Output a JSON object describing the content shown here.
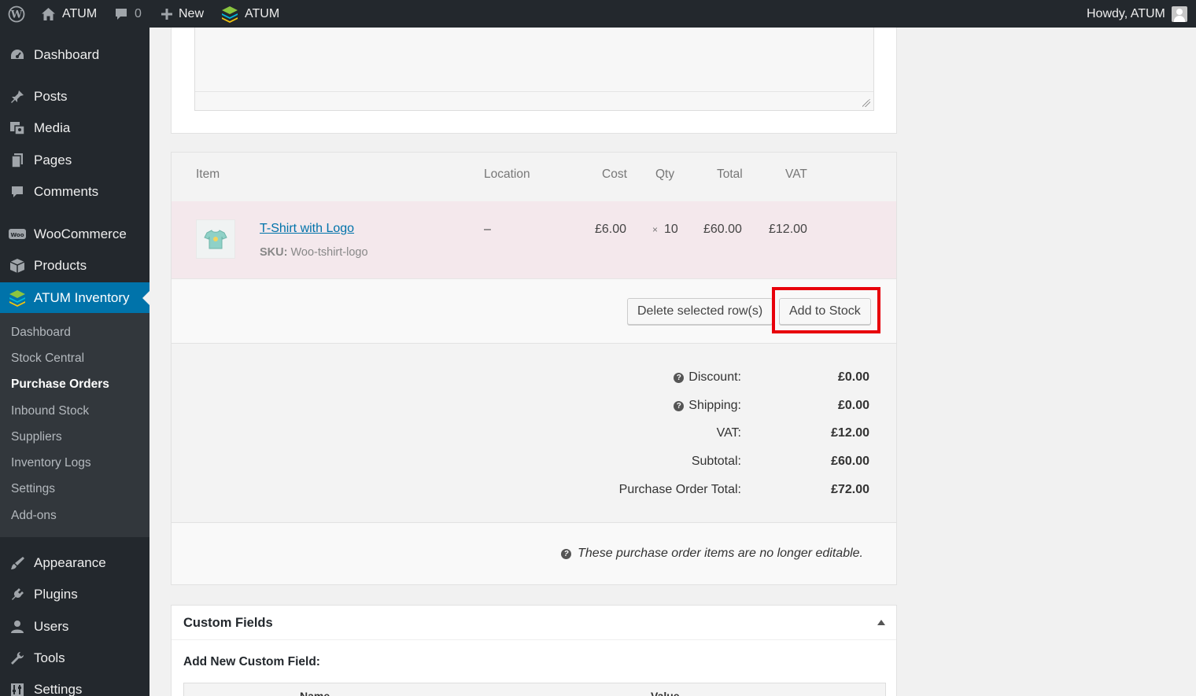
{
  "admin_bar": {
    "site_name": "ATUM",
    "comments_count": "0",
    "new_label": "New",
    "plugin_label": "ATUM",
    "greeting": "Howdy, ATUM"
  },
  "sidebar": {
    "items": [
      {
        "label": "Dashboard",
        "icon": "dashboard-icon"
      },
      {
        "label": "Posts",
        "icon": "pin-icon"
      },
      {
        "label": "Media",
        "icon": "media-icon"
      },
      {
        "label": "Pages",
        "icon": "pages-icon"
      },
      {
        "label": "Comments",
        "icon": "comment-icon"
      },
      {
        "label": "WooCommerce",
        "icon": "woo-icon"
      },
      {
        "label": "Products",
        "icon": "box-icon"
      },
      {
        "label": "ATUM Inventory",
        "icon": "atum-icon"
      },
      {
        "label": "Appearance",
        "icon": "brush-icon"
      },
      {
        "label": "Plugins",
        "icon": "plug-icon"
      },
      {
        "label": "Users",
        "icon": "user-icon"
      },
      {
        "label": "Tools",
        "icon": "wrench-icon"
      },
      {
        "label": "Settings",
        "icon": "settings-icon"
      }
    ],
    "submenu": [
      "Dashboard",
      "Stock Central",
      "Purchase Orders",
      "Inbound Stock",
      "Suppliers",
      "Inventory Logs",
      "Settings",
      "Add-ons"
    ]
  },
  "items_table": {
    "headers": {
      "item": "Item",
      "location": "Location",
      "cost": "Cost",
      "qty": "Qty",
      "total": "Total",
      "vat": "VAT"
    },
    "row": {
      "name": "T-Shirt with Logo",
      "sku_label": "SKU:",
      "sku": "Woo-tshirt-logo",
      "location": "–",
      "cost": "£6.00",
      "qty_prefix": "×",
      "qty": "10",
      "total": "£60.00",
      "vat": "£12.00"
    }
  },
  "actions": {
    "delete_label": "Delete selected row(s)",
    "add_stock_label": "Add to Stock"
  },
  "totals": {
    "discount_label": "Discount:",
    "discount": "£0.00",
    "shipping_label": "Shipping:",
    "shipping": "£0.00",
    "vat_label": "VAT:",
    "vat": "£12.00",
    "subtotal_label": "Subtotal:",
    "subtotal": "£60.00",
    "po_total_label": "Purchase Order Total:",
    "po_total": "£72.00"
  },
  "notice": "These purchase order items are no longer editable.",
  "custom_fields": {
    "title": "Custom Fields",
    "add_new_label": "Add New Custom Field:",
    "col_name": "Name",
    "col_value": "Value"
  },
  "colors": {
    "admin_dark": "#23282d",
    "accent": "#0073aa",
    "highlight": "#e8000b",
    "row_bg": "#f4e8ec"
  }
}
